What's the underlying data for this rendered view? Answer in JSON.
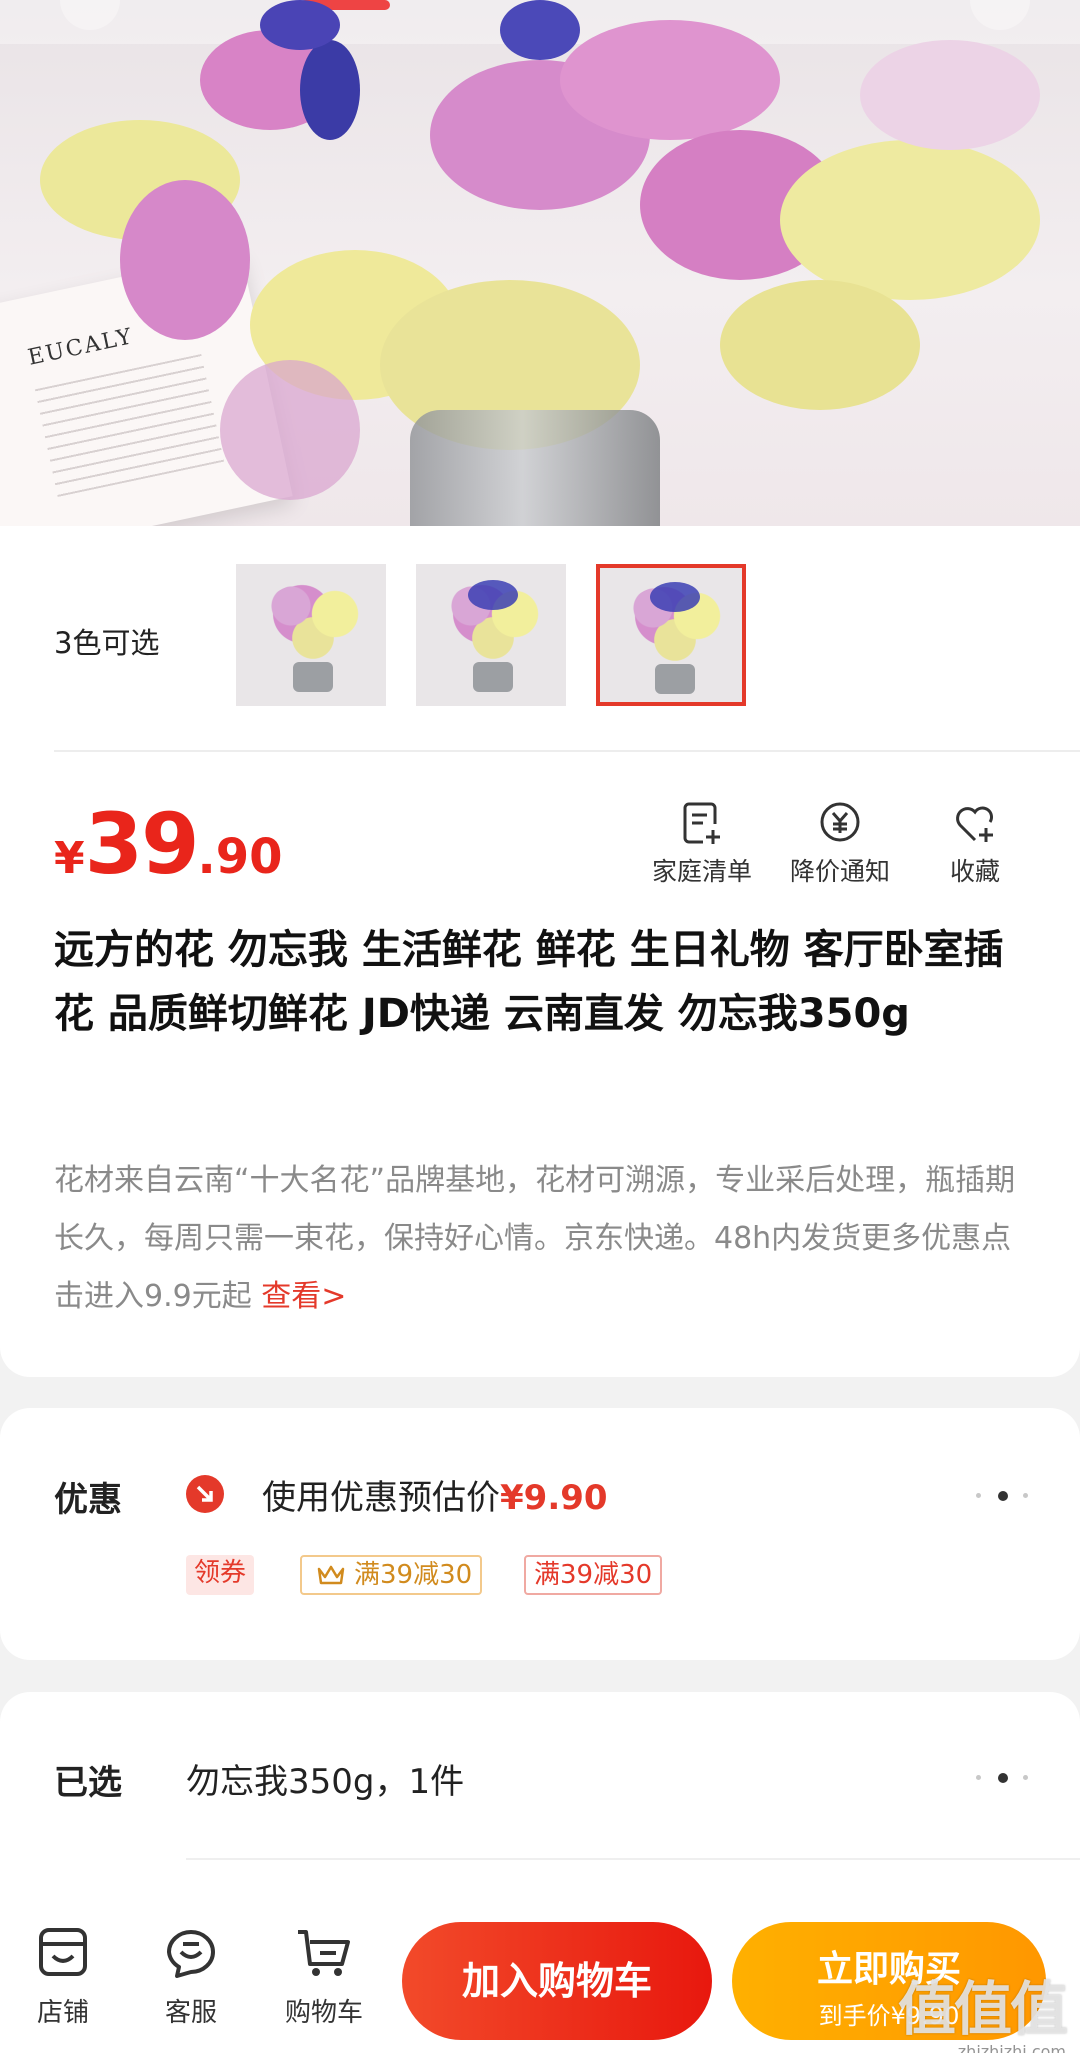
{
  "product": {
    "color_option_label": "3色可选",
    "thumbnails": [
      {
        "name": "color-option-1",
        "selected": false
      },
      {
        "name": "color-option-2",
        "selected": false
      },
      {
        "name": "color-option-3",
        "selected": true
      }
    ],
    "price": {
      "currency": "¥",
      "integer": "39",
      "decimal": ".90"
    },
    "actions": [
      {
        "icon": "list-add-icon",
        "label": "家庭清单"
      },
      {
        "icon": "price-drop-icon",
        "label": "降价通知"
      },
      {
        "icon": "heart-icon",
        "label": "收藏"
      }
    ],
    "title": "远方的花 勿忘我 生活鲜花 鲜花  生日礼物 客厅卧室插花 品质鲜切鲜花 JD快递 云南直发 勿忘我350g",
    "description": "花材来自云南“十大名花”品牌基地，花材可溯源，专业采后处理，瓶插期长久，每周只需一束花，保持好心情。京东快递。48h内发货更多优惠点击进入9.9元起 ",
    "description_link": "查看>",
    "hero_card_text": "EUCALY"
  },
  "coupon": {
    "label": "优惠",
    "estimate_prefix": "使用优惠预估价",
    "estimate_price": "¥9.90",
    "tags": [
      "领券",
      "满39减30",
      "满39减30"
    ]
  },
  "selected": {
    "label": "已选",
    "value": "勿忘我350g，1件"
  },
  "bottom_bar": {
    "store": "店铺",
    "service": "客服",
    "cart": "购物车",
    "add_to_cart": "加入购物车",
    "buy_now": "立即购买",
    "buy_now_sub": "到手价¥9.90"
  },
  "watermark": {
    "main": "值值值",
    "url": "zhizhizhi.com"
  },
  "colors": {
    "accent_red": "#e4392a",
    "price_red": "#e9251b",
    "buy_orange": "#ffa200",
    "gold": "#d18b1e"
  }
}
